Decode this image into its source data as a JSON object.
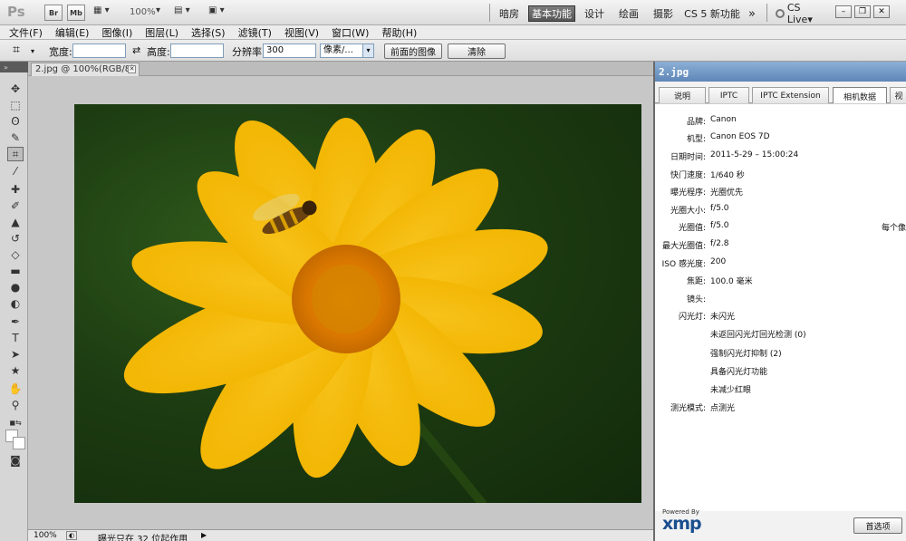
{
  "appbar": {
    "logo": "Ps",
    "bridge_btn": "Br",
    "minibridge_btn": "Mb",
    "zoom": "100%",
    "workspaces": [
      "暗房",
      "基本功能",
      "设计",
      "绘画",
      "摄影",
      "CS 5 新功能"
    ],
    "more": "»",
    "cslive": "CS Live▾"
  },
  "menu": [
    "文件(F)",
    "编辑(E)",
    "图像(I)",
    "图层(L)",
    "选择(S)",
    "滤镜(T)",
    "视图(V)",
    "窗口(W)",
    "帮助(H)"
  ],
  "options": {
    "width_label": "宽度:",
    "height_label": "高度:",
    "resolution_label": "分辨率:",
    "resolution_value": "300",
    "unit": "像素/...",
    "front_image_btn": "前面的图像",
    "clear_btn": "清除"
  },
  "document": {
    "tab_label": "2.jpg @ 100%(RGB/8)",
    "status_zoom": "100%",
    "status_text": "曝光只在 32 位起作用"
  },
  "panel": {
    "title": "2.jpg",
    "tabs": [
      "说明",
      "IPTC",
      "IPTC Extension",
      "相机数据",
      "视"
    ],
    "active_tab": "相机数据",
    "rows": [
      {
        "label": "品牌:",
        "value": "Canon"
      },
      {
        "label": "机型:",
        "value": "Canon EOS 7D"
      },
      {
        "label": "日期时间:",
        "value": "2011-5-29 – 15:00:24"
      },
      {
        "label": "快门速度:",
        "value": "1/640 秒"
      },
      {
        "label": "曝光程序:",
        "value": "光圈优先"
      },
      {
        "label": "光圈大小:",
        "value": "f/5.0"
      },
      {
        "label": "光圈值:",
        "value": "f/5.0"
      },
      {
        "label": "最大光圈值:",
        "value": "f/2.8"
      },
      {
        "label": "ISO 感光度:",
        "value": "200"
      },
      {
        "label": "焦距:",
        "value": "100.0 毫米"
      },
      {
        "label": "镜头:",
        "value": ""
      },
      {
        "label": "闪光灯:",
        "value": "未闪光"
      },
      {
        "label": "",
        "value": "未返回闪光灯回光检测 (0)"
      },
      {
        "label": "",
        "value": "强制闪光灯抑制 (2)"
      },
      {
        "label": "",
        "value": "具备闪光灯功能"
      },
      {
        "label": "",
        "value": "未减少红眼"
      },
      {
        "label": "测光模式:",
        "value": "点测光"
      }
    ],
    "extra_right": "每个像",
    "xmp_powered": "Powered By",
    "xmp_logo": "xmp",
    "prefs_btn": "首选项"
  }
}
